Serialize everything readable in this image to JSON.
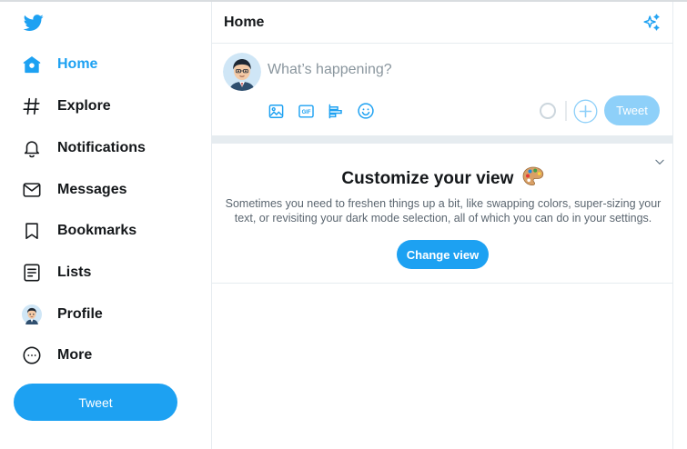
{
  "sidebar": {
    "logo_icon": "twitter-bird-icon",
    "items": [
      {
        "label": "Home",
        "icon": "home-icon",
        "active": true
      },
      {
        "label": "Explore",
        "icon": "hashtag-icon"
      },
      {
        "label": "Notifications",
        "icon": "bell-icon"
      },
      {
        "label": "Messages",
        "icon": "envelope-icon"
      },
      {
        "label": "Bookmarks",
        "icon": "bookmark-icon"
      },
      {
        "label": "Lists",
        "icon": "list-icon"
      },
      {
        "label": "Profile",
        "icon": "avatar-icon"
      },
      {
        "label": "More",
        "icon": "more-circle-icon"
      }
    ],
    "tweet_button": "Tweet"
  },
  "header": {
    "title": "Home",
    "sparkle_icon": "sparkle-icon"
  },
  "composer": {
    "placeholder": "What’s happening?",
    "tools": [
      "image-icon",
      "gif-icon",
      "poll-icon",
      "emoji-icon"
    ],
    "tweet_button": "Tweet"
  },
  "customize": {
    "title": "Customize your view",
    "description": "Sometimes you need to freshen things up a bit, like swapping colors, super-sizing your text, or revisiting your dark mode selection, all of which you can do in your settings.",
    "button": "Change view"
  },
  "colors": {
    "accent": "#1da1f2",
    "accent_disabled": "#8ed0f9",
    "border": "#e6ecf0",
    "text": "#14171a",
    "muted": "#5b6670"
  }
}
